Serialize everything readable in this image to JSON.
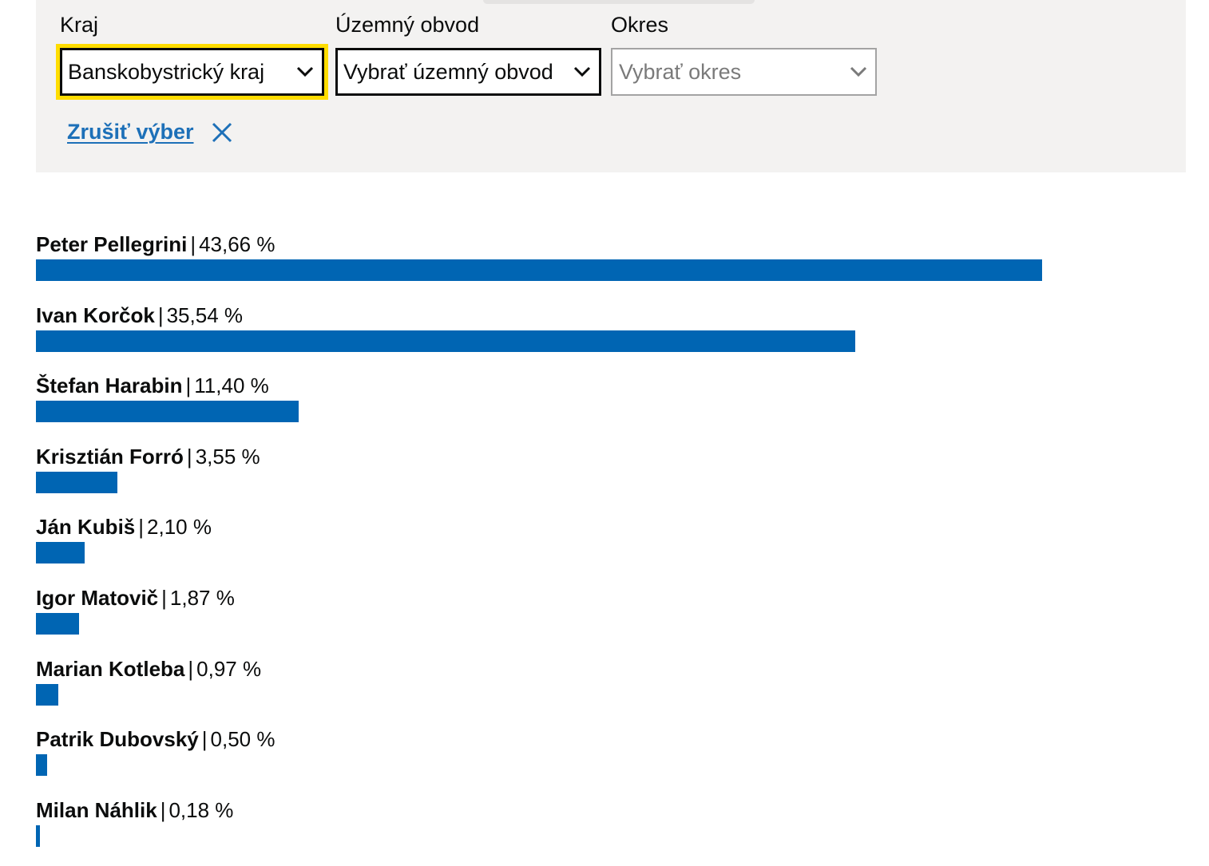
{
  "filters": {
    "kraj": {
      "label": "Kraj",
      "value": "Banskobystrický kraj"
    },
    "uzemny_obvod": {
      "label": "Územný obvod",
      "value": "Vybrať územný obvod"
    },
    "okres": {
      "label": "Okres",
      "value": "Vybrať okres"
    },
    "reset_label": "Zrušiť výber"
  },
  "colors": {
    "bar": "#0065b3",
    "link": "#1d70b8",
    "focus": "#ffdd00",
    "panel_bg": "#f3f2f1"
  },
  "results": [
    {
      "name": "Peter Pellegrini",
      "percent_text": "43,66 %",
      "percent": 43.66
    },
    {
      "name": "Ivan Korčok",
      "percent_text": "35,54 %",
      "percent": 35.54
    },
    {
      "name": "Štefan Harabin",
      "percent_text": "11,40 %",
      "percent": 11.4
    },
    {
      "name": "Krisztián Forró",
      "percent_text": "3,55 %",
      "percent": 3.55
    },
    {
      "name": "Ján Kubiš",
      "percent_text": "2,10 %",
      "percent": 2.1
    },
    {
      "name": "Igor Matovič",
      "percent_text": "1,87 %",
      "percent": 1.87
    },
    {
      "name": "Marian Kotleba",
      "percent_text": "0,97 %",
      "percent": 0.97
    },
    {
      "name": "Patrik Dubovský",
      "percent_text": "0,50 %",
      "percent": 0.5
    },
    {
      "name": "Milan Náhlik",
      "percent_text": "0,18 %",
      "percent": 0.18
    }
  ]
}
